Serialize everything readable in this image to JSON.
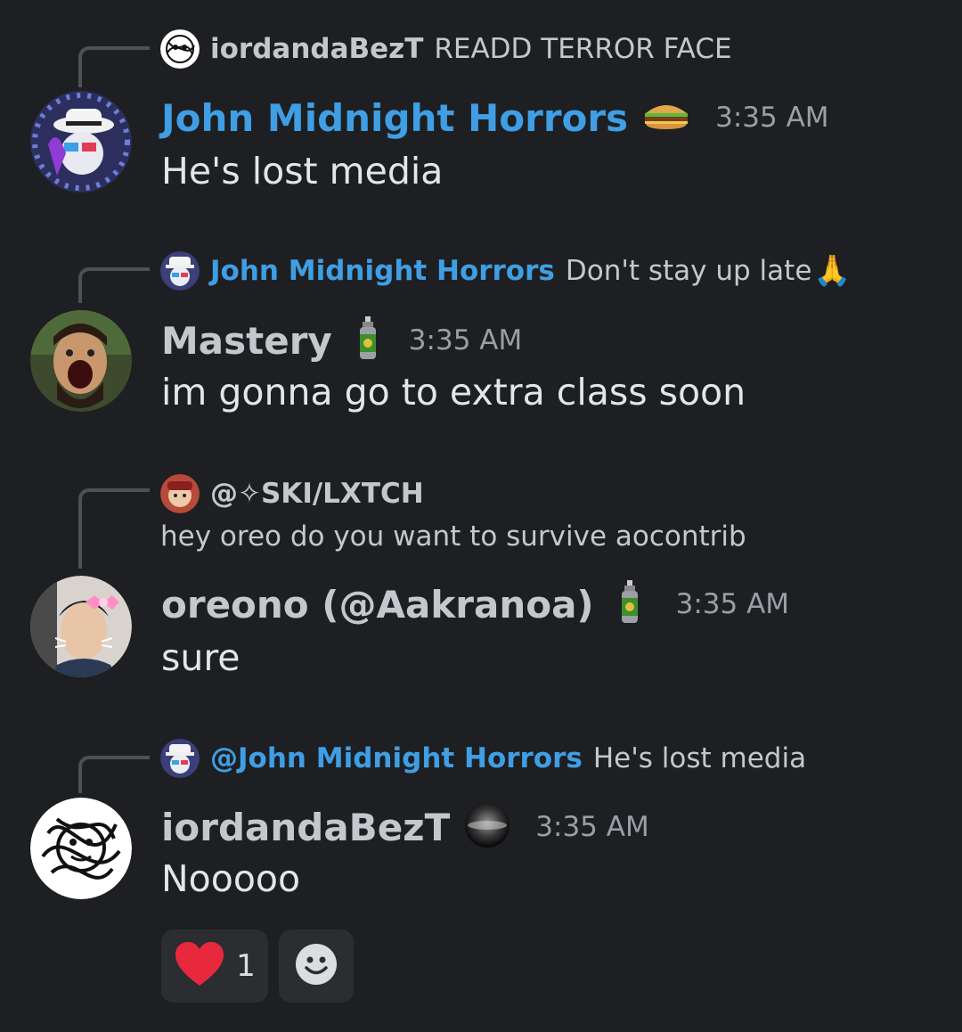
{
  "messages": [
    {
      "reply": {
        "name": "iordandaBezT",
        "text": "READD TERROR FACE"
      },
      "author": "John Midnight Horrors",
      "badge_icon": "burger-icon",
      "time": "3:35 AM",
      "text": "He's lost media"
    },
    {
      "reply": {
        "name": "John Midnight Horrors",
        "text": "Don't stay up late",
        "emoji": "🙏"
      },
      "author": "Mastery",
      "badge_icon": "spray-can-icon",
      "time": "3:35 AM",
      "text": "im gonna go to extra class soon"
    },
    {
      "reply": {
        "name": "@✧SKI/LXTCH",
        "text": "hey oreo do you want to survive aocontrib"
      },
      "author": "oreono (@Aakranoa)",
      "badge_icon": "spray-can-icon",
      "time": "3:35 AM",
      "text": "sure"
    },
    {
      "reply": {
        "name": "@John Midnight Horrors",
        "text": "He's lost media"
      },
      "author": "iordandaBezT",
      "badge_icon": "black-orb-icon",
      "time": "3:35 AM",
      "text": "Nooooo"
    }
  ],
  "reactions": [
    {
      "icon": "heart-icon",
      "emoji": "❤️",
      "count": "1"
    },
    {
      "icon": "add-reaction-icon"
    }
  ],
  "colors": {
    "background": "#1e1f22",
    "name_blue": "#3f9ee4",
    "timestamp": "#9b9ea5",
    "reaction_bg": "#2b2d31",
    "spine": "#4e5058"
  }
}
